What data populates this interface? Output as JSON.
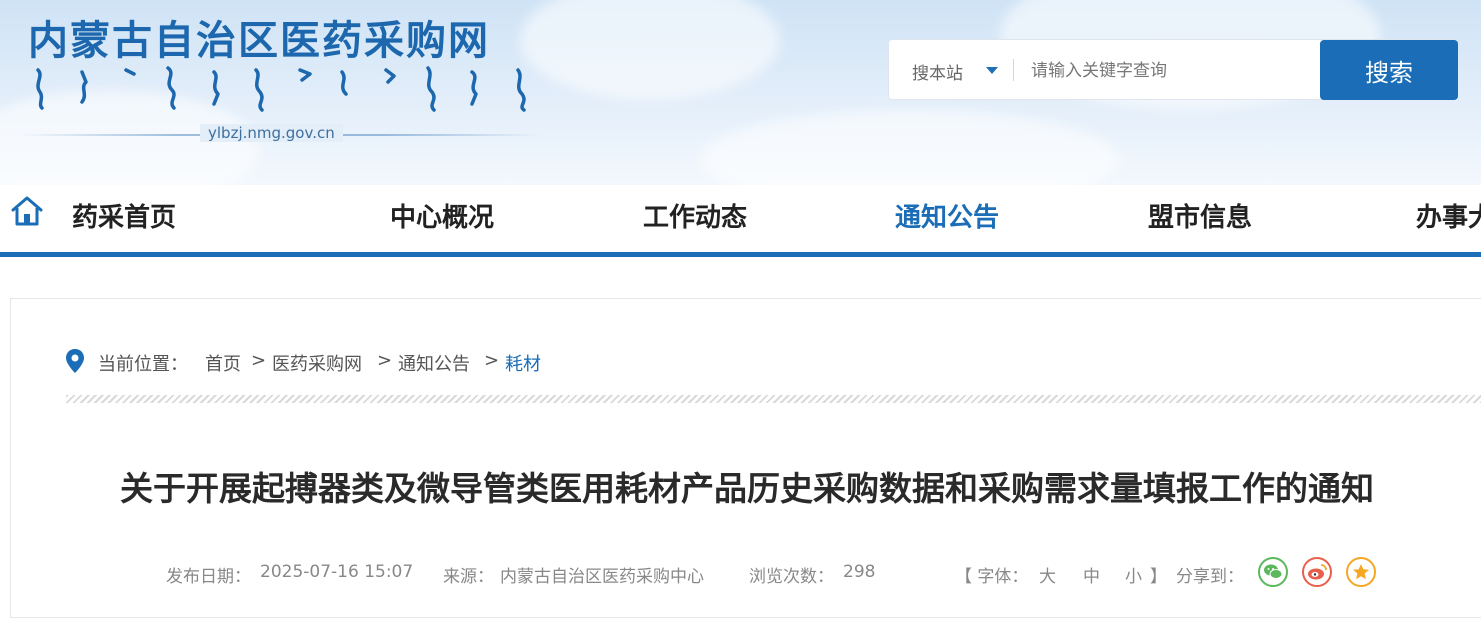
{
  "header": {
    "site_title": "内蒙古自治区医药采购网",
    "domain": "ylbzj.nmg.gov.cn"
  },
  "search": {
    "scope_label": "搜本站",
    "placeholder": "请输入关键字查询",
    "button_label": "搜索"
  },
  "nav": {
    "items": [
      {
        "label": "药采首页"
      },
      {
        "label": "中心概况"
      },
      {
        "label": "工作动态"
      },
      {
        "label": "通知公告"
      },
      {
        "label": "盟市信息"
      },
      {
        "label": "办事大"
      }
    ],
    "active": "通知公告"
  },
  "breadcrumb": {
    "label": "当前位置：",
    "items": [
      "首页",
      "医药采购网",
      "通知公告",
      "耗材"
    ],
    "separator": ">"
  },
  "article": {
    "title": "关于开展起搏器类及微导管类医用耗材产品历史采购数据和采购需求量填报工作的通知",
    "publish_date_label": "发布日期：",
    "publish_date": "2025-07-16 15:07",
    "source_label": "来源：",
    "source": "内蒙古自治区医药采购中心",
    "views_label": "浏览次数：",
    "views": "298"
  },
  "tools": {
    "font_open": "【 字体：",
    "font_large": "大",
    "font_medium": "中",
    "font_small": "小",
    "font_close": "】",
    "share_label": "分享到：",
    "share_icons": [
      "wechat-icon",
      "weibo-icon",
      "favorite-icon"
    ]
  },
  "colors": {
    "brand_blue": "#1a6db6",
    "wechat_green": "#5cb85c",
    "weibo_red": "#e8604c",
    "favorite_orange": "#f5a623"
  }
}
